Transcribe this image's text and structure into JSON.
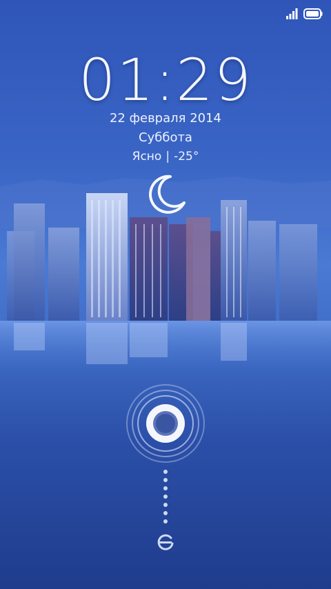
{
  "status_bar": {
    "icons": [
      "signal-icon",
      "battery-icon"
    ]
  },
  "lockscreen": {
    "time": "01:29",
    "date": "22 февраля 2014",
    "weekday": "Суббота",
    "weather": {
      "condition": "Ясно",
      "separator": "|",
      "temperature": "-25°",
      "icon": "moon-icon"
    },
    "unlock_icon": "unlock-ring-icon",
    "camera_icon": "camera-icon"
  },
  "colors": {
    "background_top": "#2f55b8",
    "background_bottom": "#1f3c8c",
    "text": "#ffffff"
  }
}
